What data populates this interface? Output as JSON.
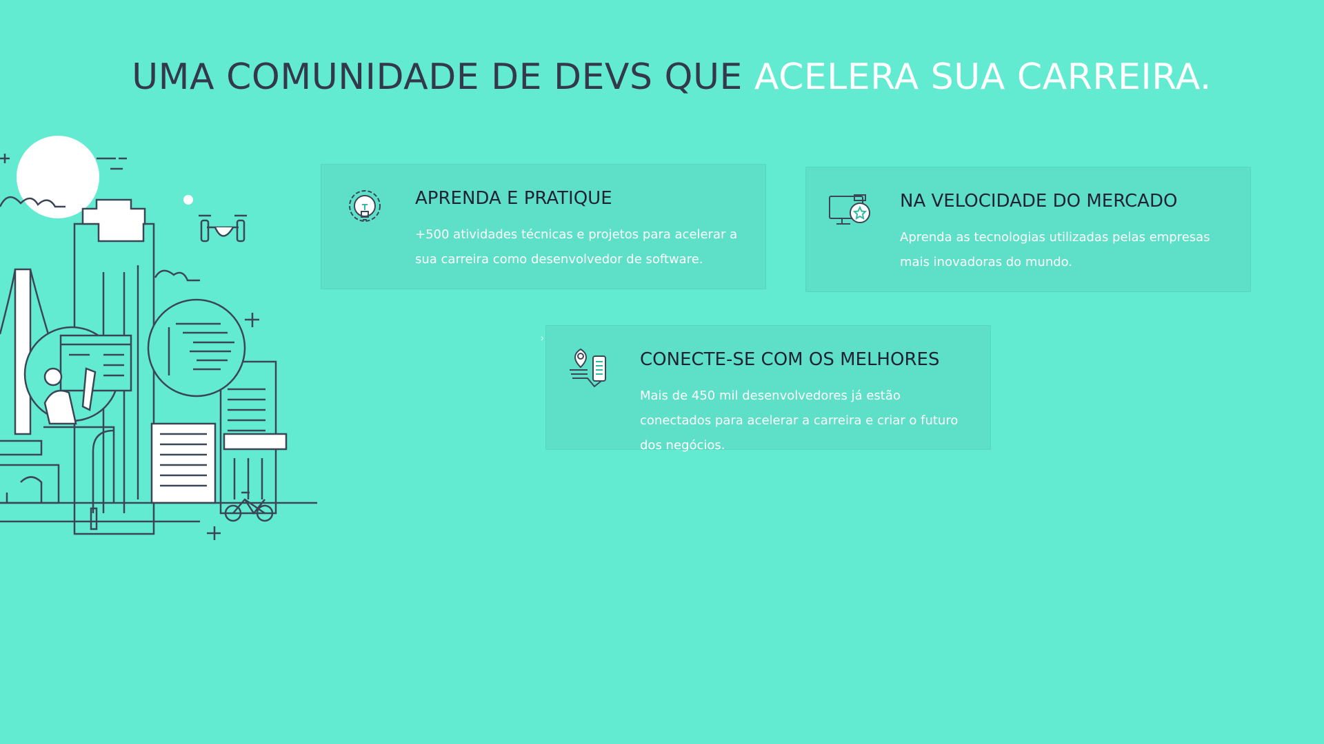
{
  "headline": {
    "dark_text": "UMA COMUNIDADE DE DEVS QUE ",
    "accent_text": "ACELERA SUA CARREIRA."
  },
  "cards": [
    {
      "icon": "lightbulb-gear-icon",
      "title": "APRENDA E PRATIQUE",
      "text": "+500 atividades técnicas e projetos para acelerar a sua carreira como desenvolvedor de software."
    },
    {
      "icon": "monitor-star-icon",
      "title": "NA VELOCIDADE DO MERCADO",
      "text": "Aprenda as tecnologias utilizadas pelas empresas mais inovadoras do mundo."
    },
    {
      "icon": "map-pin-phone-icon",
      "title": "CONECTE-SE COM OS MELHORES",
      "text": "Mais de 450 mil desenvolvedores já estão conectados para acelerar a carreira e criar o futuro dos negócios."
    }
  ],
  "colors": {
    "background": "#63ebd1",
    "card": "#5de0c7",
    "dark_text": "#33384a",
    "accent_text": "#ffffff",
    "line_art": "#3a4556"
  }
}
